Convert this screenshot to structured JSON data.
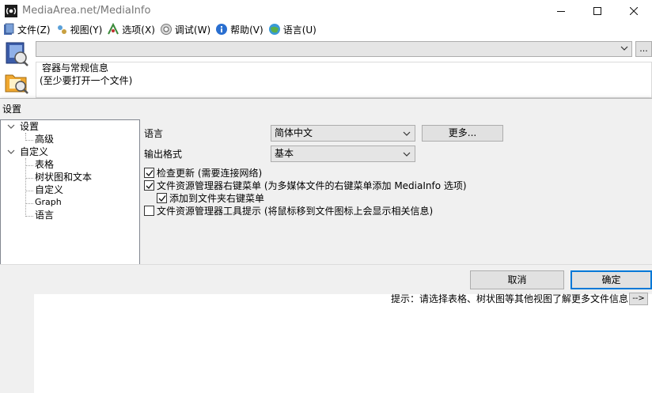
{
  "window": {
    "title": "MediaArea.net/MediaInfo",
    "icon": "mediainfo-logo-icon",
    "controls": [
      "minimize-icon",
      "maximize-icon",
      "close-icon"
    ]
  },
  "menubar": {
    "items": [
      {
        "label": "文件(Z)",
        "icon": "file-icon"
      },
      {
        "label": "视图(Y)",
        "icon": "view-icon"
      },
      {
        "label": "选项(X)",
        "icon": "options-icon"
      },
      {
        "label": "调试(W)",
        "icon": "debug-icon"
      },
      {
        "label": "帮助(V)",
        "icon": "help-icon"
      },
      {
        "label": "语言(U)",
        "icon": "language-icon"
      }
    ]
  },
  "toolbar": {
    "open_file_icon": "open-file-icon",
    "open_folder_icon": "open-folder-icon",
    "more_button_label": "..."
  },
  "info_panel": {
    "line1": "容器与常规信息",
    "line2": "(至少要打开一个文件)"
  },
  "dialog": {
    "title": "设置",
    "tree": [
      {
        "label": "设置",
        "level": 0,
        "expanded": true
      },
      {
        "label": "高级",
        "level": 1
      },
      {
        "label": "自定义",
        "level": 0,
        "expanded": true
      },
      {
        "label": "表格",
        "level": 1
      },
      {
        "label": "树状图和文本",
        "level": 1
      },
      {
        "label": "自定义",
        "level": 1
      },
      {
        "label": "Graph",
        "level": 1
      },
      {
        "label": "语言",
        "level": 1
      }
    ],
    "language_label": "语言",
    "language_value": "简体中文",
    "more_button": "更多...",
    "output_label": "输出格式",
    "output_value": "基本",
    "checkboxes": [
      {
        "label": "检查更新 (需要连接网络)",
        "checked": true
      },
      {
        "label": "文件资源管理器右键菜单 (为多媒体文件的右键菜单添加 MediaInfo 选项)",
        "checked": true
      },
      {
        "label": "添加到文件夹右键菜单",
        "checked": true
      },
      {
        "label": "文件资源管理器工具提示 (将鼠标移到文件图标上会显示相关信息)",
        "checked": false
      }
    ],
    "cancel_button": "取消",
    "ok_button": "确定"
  },
  "status": {
    "tip": "提示：请选择表格、树状图等其他视图了解更多文件信息",
    "tip_button": "-->"
  },
  "colors": {
    "accent": "#0078d7",
    "dialog_bg": "#f0f0f0",
    "button_bg": "#e1e1e1"
  }
}
